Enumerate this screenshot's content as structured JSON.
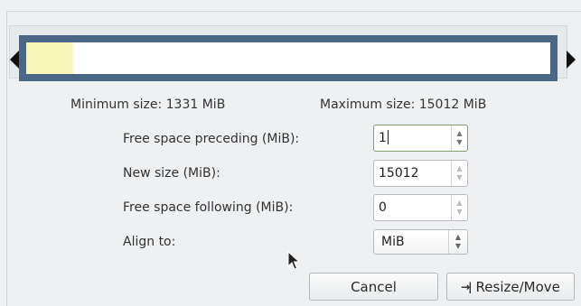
{
  "visualizer": {
    "used_fraction": 0.089
  },
  "size_info": {
    "minimum": "Minimum size: 1331 MiB",
    "maximum": "Maximum size: 15012 MiB"
  },
  "fields": {
    "preceding": {
      "label": "Free space preceding (MiB):",
      "value": "1"
    },
    "new_size": {
      "label": "New size (MiB):",
      "value": "15012"
    },
    "following": {
      "label": "Free space following (MiB):",
      "value": "0"
    },
    "align": {
      "label": "Align to:",
      "value": "MiB"
    }
  },
  "buttons": {
    "cancel": "Cancel",
    "resize_move": "Resize/Move"
  },
  "icons": {
    "resize_move": "arrow-to-bar-icon"
  },
  "colors": {
    "border": "#4a6786",
    "used": "#f7f6b8",
    "free": "#ffffff"
  }
}
